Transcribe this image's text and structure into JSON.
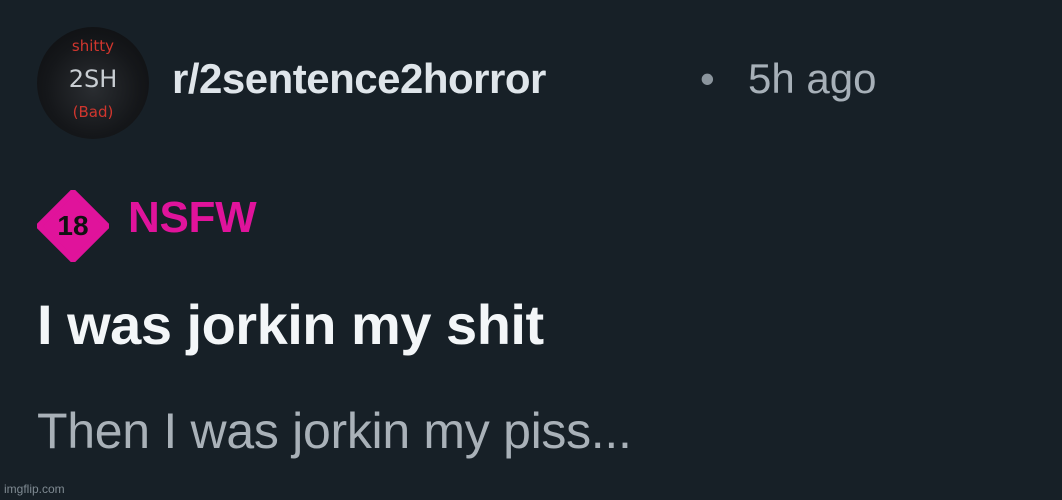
{
  "header": {
    "subreddit": "r/2sentence2horror",
    "separator": "•",
    "timestamp": "5h ago",
    "avatar": {
      "icon": "subreddit-avatar",
      "text_top": "shitty",
      "text_mid": "2SH",
      "text_bottom": "(Bad)"
    }
  },
  "tag": {
    "badge_number": "18",
    "label": "NSFW",
    "color": "#e0139b"
  },
  "post": {
    "title": "I was jorkin my shit",
    "body": "Then I was jorkin my piss..."
  },
  "watermark": "imgflip.com",
  "colors": {
    "background": "#172027",
    "title": "#f3f6f8",
    "body": "#a9b1b8",
    "accent_nsfw": "#e0139b"
  }
}
